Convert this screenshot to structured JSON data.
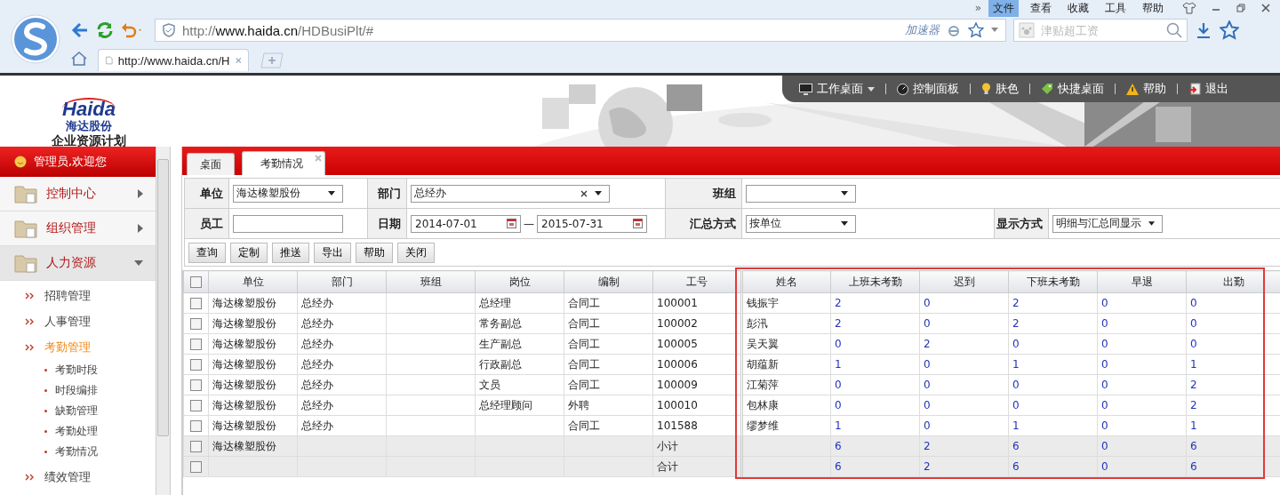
{
  "browser": {
    "more": "»",
    "menu": [
      {
        "label": "文件",
        "selected": true
      },
      {
        "label": "查看",
        "selected": false
      },
      {
        "label": "收藏",
        "selected": false
      },
      {
        "label": "工具",
        "selected": false
      },
      {
        "label": "帮助",
        "selected": false
      }
    ],
    "address": {
      "scheme": "http://",
      "host": "www.haida.cn",
      "path": "/HDBusiPlt/#",
      "accelerator": "加速器"
    },
    "search": {
      "placeholder": "津贴超工资"
    },
    "tab": {
      "title": "http://www.haida.cn/H"
    }
  },
  "header": {
    "logo": "Haida",
    "logo_cn": "海达股份",
    "subtitle": "企业资源计划",
    "toolbar": [
      {
        "label": "工作桌面",
        "kind": "monitor",
        "has_menu": true
      },
      {
        "label": "控制面板",
        "kind": "gauge",
        "has_menu": false
      },
      {
        "label": "肤色",
        "kind": "bulb",
        "has_menu": false
      },
      {
        "label": "快捷桌面",
        "kind": "tag",
        "has_menu": false
      },
      {
        "label": "帮助",
        "kind": "warning",
        "has_menu": false
      },
      {
        "label": "退出",
        "kind": "exit",
        "has_menu": false
      }
    ]
  },
  "sidebar": {
    "user": "管理员,欢迎您",
    "sections": [
      {
        "label": "控制中心",
        "expanded": false
      },
      {
        "label": "组织管理",
        "expanded": false
      },
      {
        "label": "人力资源",
        "expanded": true,
        "children": [
          {
            "label": "招聘管理",
            "selected": false
          },
          {
            "label": "人事管理",
            "selected": false
          },
          {
            "label": "考勤管理",
            "selected": true,
            "children": [
              {
                "label": "考勤时段"
              },
              {
                "label": "时段编排"
              },
              {
                "label": "缺勤管理"
              },
              {
                "label": "考勤处理"
              },
              {
                "label": "考勤情况"
              }
            ]
          },
          {
            "label": "绩效管理",
            "selected": false
          }
        ]
      }
    ]
  },
  "tabs": [
    {
      "label": "桌面",
      "selected": false,
      "closable": false
    },
    {
      "label": "考勤情况",
      "selected": true,
      "closable": true
    }
  ],
  "filters": [
    [
      {
        "label": "单位",
        "kind": "select",
        "value": "海达橡塑股份"
      },
      {
        "label": "部门",
        "kind": "select_clear",
        "value": "总经办"
      },
      {
        "label": "班组",
        "kind": "select"
      }
    ],
    [
      {
        "label": "员工",
        "kind": "input"
      },
      {
        "label": "日期",
        "kind": "daterange",
        "from": "2014-07-01",
        "separator": "—",
        "to": "2015-07-31"
      },
      {
        "label": "汇总方式",
        "kind": "select",
        "value": "按单位"
      },
      {
        "label": "显示方式",
        "kind": "select",
        "value": "明细与汇总同显示"
      }
    ]
  ],
  "buttons": [
    "查询",
    "定制",
    "推送",
    "导出",
    "帮助",
    "关闭"
  ],
  "table": {
    "all_checked": false,
    "columns": [
      {
        "label": "单位",
        "kind": "text"
      },
      {
        "label": "部门",
        "kind": "text"
      },
      {
        "label": "班组",
        "kind": "text"
      },
      {
        "label": "岗位",
        "kind": "text"
      },
      {
        "label": "编制",
        "kind": "text"
      },
      {
        "label": "工号",
        "kind": "text"
      },
      {
        "label": "姓名",
        "kind": "text"
      },
      {
        "label": "上班未考勤",
        "kind": "number"
      },
      {
        "label": "迟到",
        "kind": "number"
      },
      {
        "label": "下班未考勤",
        "kind": "number"
      },
      {
        "label": "早退",
        "kind": "number"
      },
      {
        "label": "出勤",
        "kind": "number"
      }
    ],
    "rows": [
      {
        "kind": "detail",
        "checked": false,
        "cells": [
          "海达橡塑股份",
          "总经办",
          "",
          "总经理",
          "合同工",
          "100001",
          "钱振宇",
          "2",
          "0",
          "2",
          "0",
          "0"
        ]
      },
      {
        "kind": "detail",
        "checked": false,
        "cells": [
          "海达橡塑股份",
          "总经办",
          "",
          "常务副总",
          "合同工",
          "100002",
          "彭汛",
          "2",
          "0",
          "2",
          "0",
          "0"
        ]
      },
      {
        "kind": "detail",
        "checked": false,
        "cells": [
          "海达橡塑股份",
          "总经办",
          "",
          "生产副总",
          "合同工",
          "100005",
          "吴天翼",
          "0",
          "2",
          "0",
          "0",
          "0"
        ]
      },
      {
        "kind": "detail",
        "checked": false,
        "cells": [
          "海达橡塑股份",
          "总经办",
          "",
          "行政副总",
          "合同工",
          "100006",
          "胡蕴新",
          "1",
          "0",
          "1",
          "0",
          "1"
        ]
      },
      {
        "kind": "detail",
        "checked": false,
        "cells": [
          "海达橡塑股份",
          "总经办",
          "",
          "文员",
          "合同工",
          "100009",
          "江菊萍",
          "0",
          "0",
          "0",
          "0",
          "2"
        ]
      },
      {
        "kind": "detail",
        "checked": false,
        "cells": [
          "海达橡塑股份",
          "总经办",
          "",
          "总经理顾问",
          "外聘",
          "100010",
          "包林康",
          "0",
          "0",
          "0",
          "0",
          "2"
        ]
      },
      {
        "kind": "detail",
        "checked": false,
        "cells": [
          "海达橡塑股份",
          "总经办",
          "",
          "",
          "合同工",
          "101588",
          "缪梦维",
          "1",
          "0",
          "1",
          "0",
          "1"
        ]
      },
      {
        "kind": "summary",
        "checked": false,
        "cells": [
          "海达橡塑股份",
          "",
          "",
          "",
          "",
          "小计",
          "",
          "6",
          "2",
          "6",
          "0",
          "6"
        ]
      },
      {
        "kind": "summary",
        "checked": false,
        "cells": [
          "",
          "",
          "",
          "",
          "",
          "合计",
          "",
          "6",
          "2",
          "6",
          "0",
          "6"
        ]
      }
    ]
  }
}
